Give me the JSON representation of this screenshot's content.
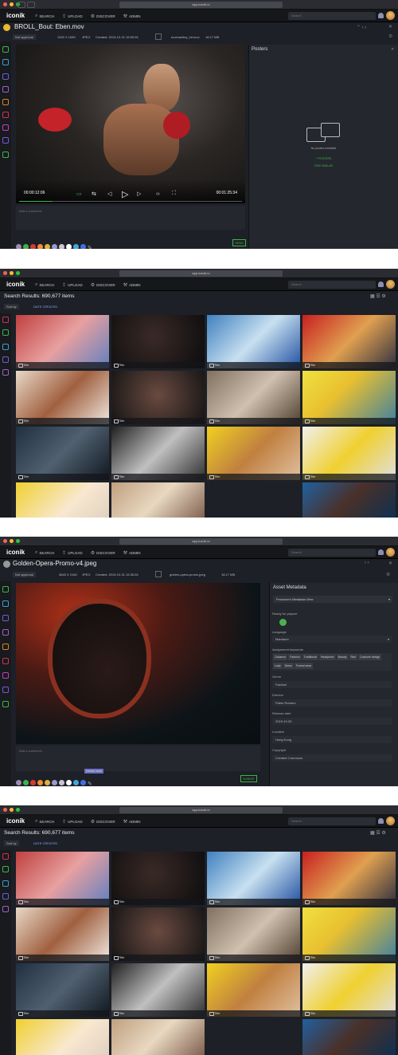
{
  "browser": {
    "url": "app.iconik.io"
  },
  "app": {
    "logo": "iconik",
    "nav": [
      {
        "label": "SEARCH",
        "icon": "search-icon"
      },
      {
        "label": "UPLOAD",
        "icon": "upload-icon"
      },
      {
        "label": "DISCOVER",
        "icon": "discover-icon"
      },
      {
        "label": "ADMIN",
        "icon": "admin-icon"
      }
    ],
    "search_placeholder": "Search"
  },
  "s1": {
    "title": "BROLL_Bout: Eben.mov",
    "status": "Not approval",
    "resolution": "1920 X 1080",
    "format": "JPEG",
    "created": "Created: 2019-10-31 15:55:26",
    "filename": "muchantley_int.mov",
    "filesize": "18.17 MB",
    "timecode_left": "00:00:12:06",
    "timecode_right": "00:01:25:34",
    "comment_placeholder": "Add a comment...",
    "send": "SEND",
    "panel_title": "Posters",
    "no_posters": "No posters available",
    "panel_link1": "+ POSTERS",
    "panel_link2": "FIND SIMILAR"
  },
  "s2": {
    "title": "Search Results: 690,677 items",
    "sort": "Sort by",
    "filter": "DATE CREATED",
    "tile_label": "Title"
  },
  "s3": {
    "title": "Golden-Opera-Promo-v4.jpeg",
    "status": "Not approval",
    "resolution": "3840 X 2160",
    "format": "JPEG",
    "created": "Created: 2019-10-31 15:35:26",
    "filename": "golden-opera-promo.jpeg",
    "filesize": "18.17 MB",
    "comment_placeholder": "Add a comment...",
    "submit": "SUBMIT",
    "tooltip": "Default mark",
    "panel_title": "Asset Metadata",
    "view": "Producer's Metadata View",
    "fields": [
      {
        "label": "Ready for playout",
        "value": ""
      },
      {
        "label": "Language",
        "value": "Mandarin"
      },
      {
        "label": "Assignment keywords",
        "value": ""
      },
      {
        "label": "Genre",
        "value": "Fashion"
      },
      {
        "label": "Director",
        "value": "Pablo Romero"
      },
      {
        "label": "Release date",
        "value": "2019-10-30"
      },
      {
        "label": "Location",
        "value": "Hong Kong"
      },
      {
        "label": "Copyright",
        "value": "Creative Commons"
      }
    ],
    "keywords": [
      "Cadanno",
      "Fashion",
      "Traditional",
      "Headpiece",
      "Beauty",
      "Red",
      "Costume design",
      "Lady",
      "Dress",
      "Formal wear"
    ]
  },
  "s4": {
    "title": "Search Results: 690,677 items",
    "sort": "Sort by",
    "filter": "DATE CREATED",
    "tile_label": "Title"
  },
  "colors": {
    "swatches": [
      "#9b8cb0",
      "#3fb24a",
      "#d83a2e",
      "#f09030",
      "#e0b040",
      "#9a9ad0",
      "#c8c8d0",
      "#ffffff",
      "#3fa8e0",
      "#4070e0"
    ],
    "accent": "#4caf50"
  }
}
